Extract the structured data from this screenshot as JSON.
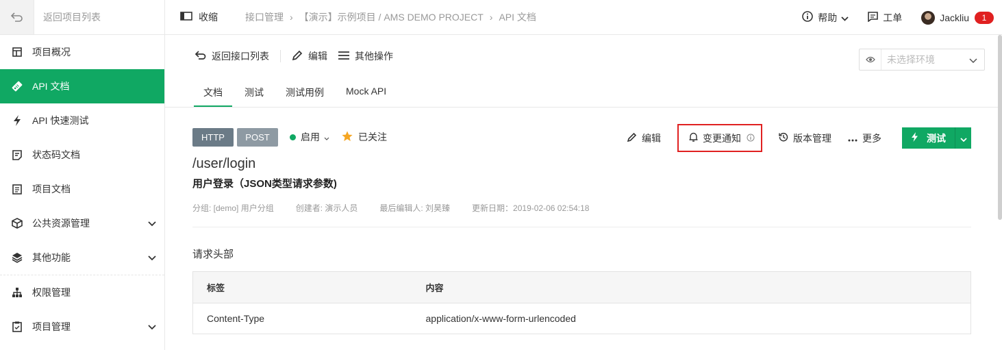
{
  "sidebar": {
    "back_label": "返回项目列表",
    "items": [
      {
        "label": "项目概况",
        "icon": "dashboard-icon"
      },
      {
        "label": "API 文档",
        "icon": "api-tag-icon",
        "active": true
      },
      {
        "label": "API 快速测试",
        "icon": "bolt-icon"
      },
      {
        "label": "状态码文档",
        "icon": "code-doc-icon"
      },
      {
        "label": "项目文档",
        "icon": "doc-icon"
      },
      {
        "label": "公共资源管理",
        "icon": "cube-icon",
        "expandable": true
      },
      {
        "label": "其他功能",
        "icon": "layers-icon",
        "expandable": true
      },
      {
        "label": "权限管理",
        "icon": "org-chart-icon"
      },
      {
        "label": "项目管理",
        "icon": "clipboard-icon",
        "expandable": true
      }
    ]
  },
  "topbar": {
    "collapse_label": "收缩",
    "breadcrumb": [
      "接口管理",
      "【演示】示例项目 / AMS DEMO PROJECT",
      "API 文档"
    ],
    "help_label": "帮助",
    "ticket_label": "工单",
    "user_name": "Jackliu",
    "notification_count": "1"
  },
  "actions": {
    "back_label": "返回接口列表",
    "edit_label": "编辑",
    "more_label": "其他操作",
    "env_placeholder": "未选择环境"
  },
  "tabs": [
    "文档",
    "测试",
    "测试用例",
    "Mock API"
  ],
  "api": {
    "protocol": "HTTP",
    "method": "POST",
    "status": "启用",
    "follow_label": "已关注",
    "path": "/user/login",
    "name": "用户登录（JSON类型请求参数)",
    "meta": {
      "group": "分组: [demo] 用户分组",
      "creator": "创建者: 演示人员",
      "editor": "最后编辑人: 刘昊臻",
      "updated": "更新日期：2019-02-06 02:54:18"
    },
    "tools": {
      "edit": "编辑",
      "notify": "变更通知",
      "version": "版本管理",
      "more": "更多",
      "test": "测试"
    }
  },
  "request_headers": {
    "title": "请求头部",
    "columns": [
      "标签",
      "内容"
    ],
    "rows": [
      [
        "Content-Type",
        "application/x-www-form-urlencoded"
      ]
    ]
  },
  "colors": {
    "accent": "#10a863",
    "highlight": "#e02020",
    "chip_http": "#6b7b87",
    "chip_post": "#8e9aa3"
  }
}
